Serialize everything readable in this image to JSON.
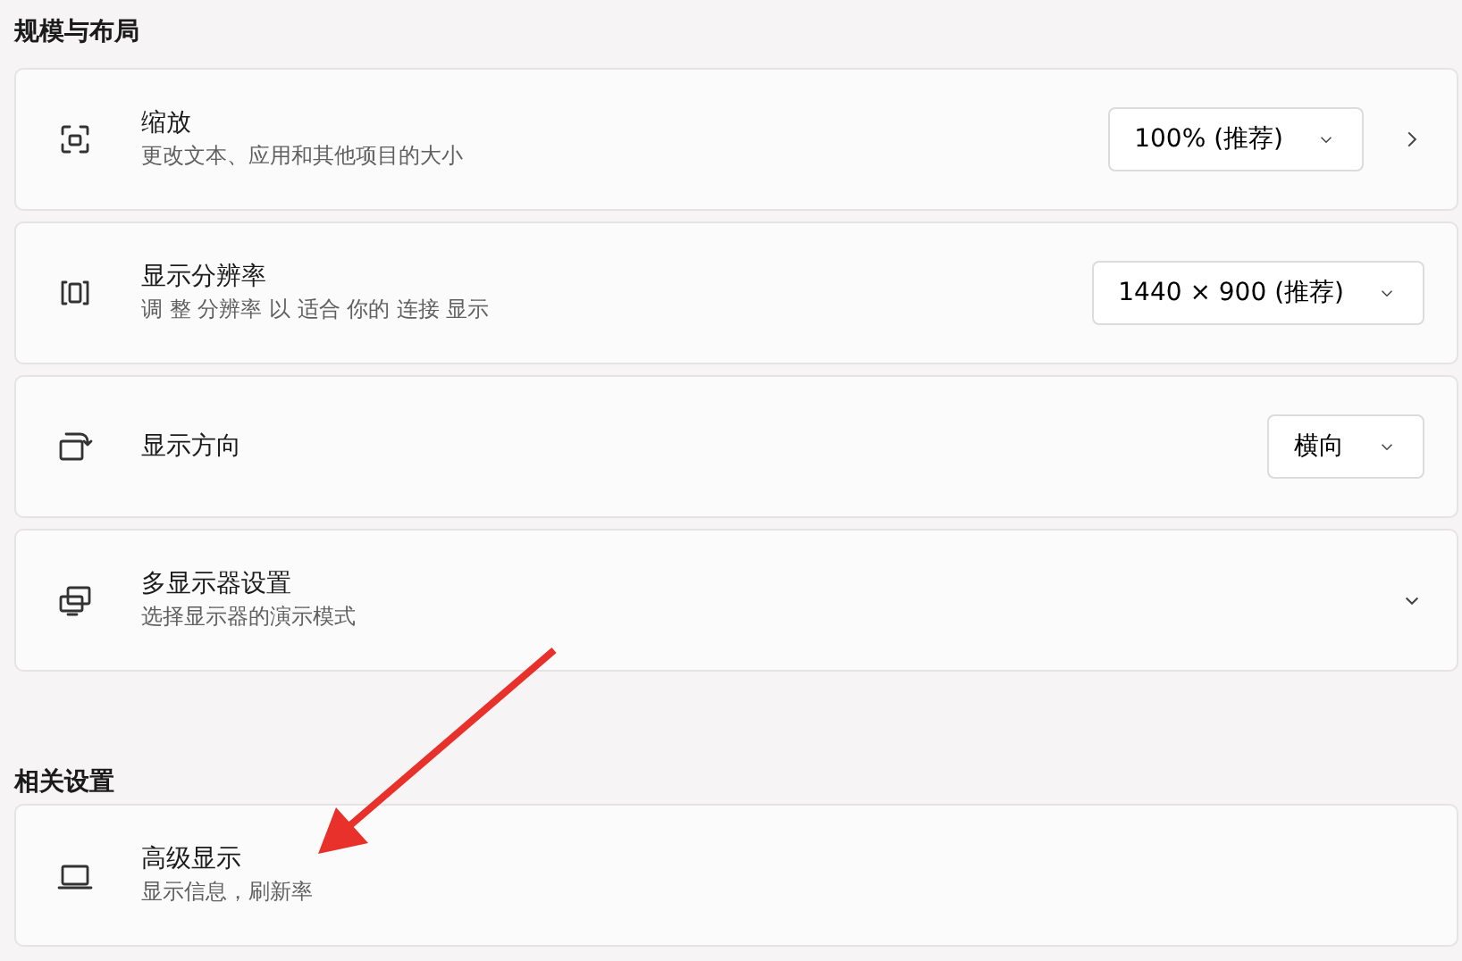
{
  "sections": [
    {
      "title": "规模与布局",
      "items": [
        {
          "kind": "dropdown",
          "title": "缩放",
          "subtitle": "更改文本、应用和其他项目的大小",
          "value": "100% (推荐)",
          "navigate": true
        },
        {
          "kind": "dropdown",
          "title": "显示分辨率",
          "subtitle": "调 整 分辨率 以 适合 你的 连接 显示",
          "value": "1440 × 900 (推荐)",
          "navigate": false
        },
        {
          "kind": "dropdown",
          "title": "显示方向",
          "value": "横向",
          "navigate": false
        },
        {
          "kind": "expander",
          "title": "多显示器设置",
          "subtitle": "选择显示器的演示模式",
          "expanded": false
        }
      ]
    },
    {
      "title": "相关设置",
      "items": [
        {
          "kind": "link",
          "title": "高级显示",
          "subtitle": "显示信息，刷新率"
        }
      ]
    }
  ]
}
